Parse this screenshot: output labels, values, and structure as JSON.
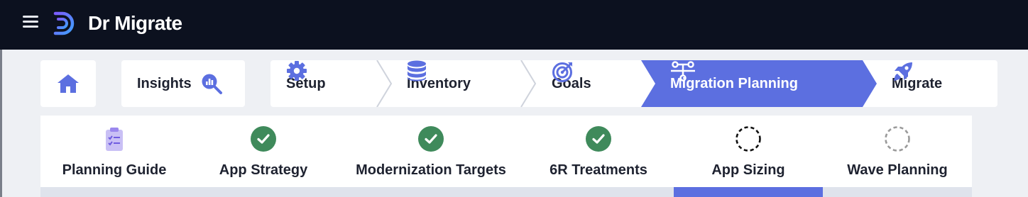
{
  "app": {
    "name": "Dr Migrate",
    "logo_icon": "dr-migrate-logo-icon",
    "menu_icon": "hamburger-menu-icon"
  },
  "colors": {
    "topbar": "#0c111f",
    "accent": "#5c6fe0",
    "done": "#3f8a5b",
    "text": "#1e2230"
  },
  "breadcrumb": {
    "home": {
      "icon": "home-icon"
    },
    "insights": {
      "label": "Insights",
      "icon": "insights-search-chart-icon"
    },
    "steps": [
      {
        "label": "Setup",
        "icon": "gear-icon",
        "active": false
      },
      {
        "label": "Inventory",
        "icon": "database-icon",
        "active": false
      },
      {
        "label": "Goals",
        "icon": "target-icon",
        "active": false
      },
      {
        "label": "Migration Planning",
        "icon": "network-flow-icon",
        "active": true
      },
      {
        "label": "Migrate",
        "icon": "rocket-icon",
        "active": false
      }
    ]
  },
  "tabs": [
    {
      "label": "Planning Guide",
      "icon": "clipboard-checklist-icon",
      "status": "guide"
    },
    {
      "label": "App Strategy",
      "icon": "check-circle-icon",
      "status": "complete"
    },
    {
      "label": "Modernization Targets",
      "icon": "check-circle-icon",
      "status": "complete"
    },
    {
      "label": "6R Treatments",
      "icon": "check-circle-icon",
      "status": "complete"
    },
    {
      "label": "App Sizing",
      "icon": "dashed-circle-icon",
      "status": "in-progress",
      "selected": true
    },
    {
      "label": "Wave Planning",
      "icon": "dashed-circle-icon",
      "status": "not-started"
    }
  ]
}
